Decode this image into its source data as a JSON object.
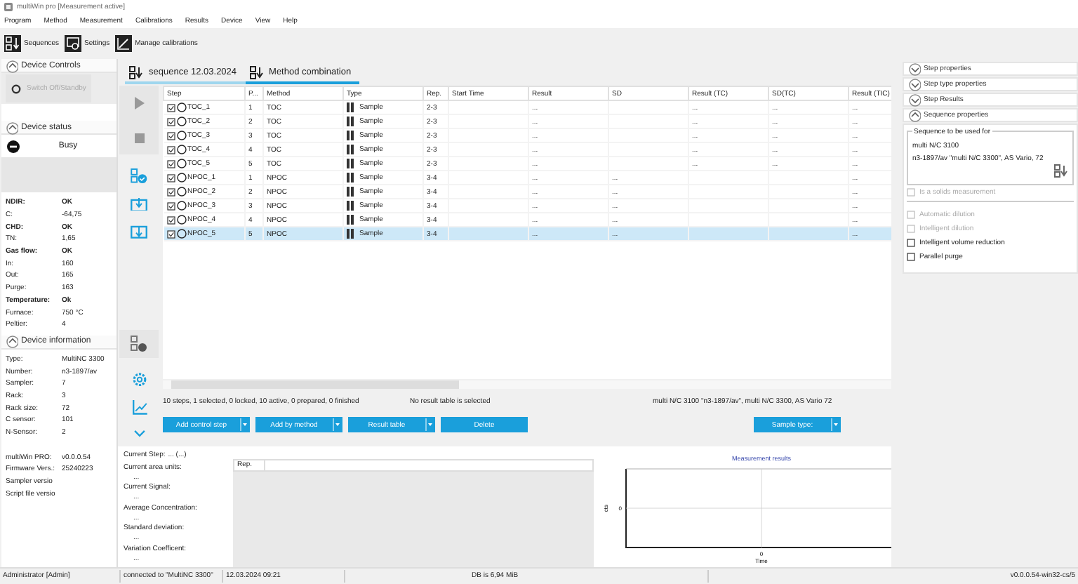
{
  "window": {
    "title": "multiWin pro [Measurement active]"
  },
  "menu": [
    "Program",
    "Method",
    "Measurement",
    "Calibrations",
    "Results",
    "Device",
    "View",
    "Help"
  ],
  "toolbar": [
    {
      "label": "Sequences",
      "kind": "sequences"
    },
    {
      "label": "Settings",
      "kind": "settings"
    },
    {
      "label": "Manage calibrations",
      "kind": "calibrations"
    }
  ],
  "device_controls": {
    "title": "Device Controls",
    "expanded": true,
    "button": {
      "label": "Switch Off/Standby",
      "disabled": true
    }
  },
  "device_status": {
    "title": "Device status",
    "expanded": true,
    "state": "Busy",
    "readings": [
      {
        "label": "NDIR:",
        "value": "OK",
        "kind": "group"
      },
      {
        "label": "C:",
        "value": "-64,75",
        "kind": "item"
      },
      {
        "label": "CHD:",
        "value": "OK",
        "kind": "group"
      },
      {
        "label": "TN:",
        "value": "1,65",
        "kind": "item"
      },
      {
        "label": "Gas flow:",
        "value": "OK",
        "kind": "group"
      },
      {
        "label": "In:",
        "value": "160",
        "kind": "item"
      },
      {
        "label": "Out:",
        "value": "165",
        "kind": "item"
      },
      {
        "label": "Purge:",
        "value": "163",
        "kind": "item"
      },
      {
        "label": "Temperature:",
        "value": "Ok",
        "kind": "group"
      },
      {
        "label": "Furnace:",
        "value": "750 °C",
        "kind": "item"
      },
      {
        "label": "Peltier:",
        "value": "4",
        "kind": "item"
      }
    ]
  },
  "device_information": {
    "title": "Device information",
    "expanded": true,
    "hardware": [
      {
        "label": "Type:",
        "value": "MultiNC 3300"
      },
      {
        "label": "Number:",
        "value": "n3-1897/av"
      },
      {
        "label": "Sampler:",
        "value": "7"
      },
      {
        "label": "Rack:",
        "value": "3"
      },
      {
        "label": "Rack size:",
        "value": "72"
      },
      {
        "label": "C sensor:",
        "value": "101"
      },
      {
        "label": "N-Sensor:",
        "value": "2"
      }
    ],
    "software": [
      {
        "label": "multiWin PRO:",
        "value": "v0.0.0.54"
      },
      {
        "label": "Firmware Vers.:",
        "value": "25240223"
      },
      {
        "label": "Sampler versio"
      },
      {
        "label": "Script file versio"
      }
    ]
  },
  "tabs": [
    {
      "label": "sequence 12.03.2024",
      "selected": false
    },
    {
      "label": "Method combination",
      "selected": true
    }
  ],
  "table": {
    "columns": [
      "Step",
      "P...",
      "Method",
      "Type",
      "Rep.",
      "Start Time",
      "Result",
      "SD",
      "Result (TC)",
      "SD(TC)",
      "Result (TIC)"
    ],
    "rows": [
      {
        "checked": true,
        "selected": false,
        "cells": [
          "TOC_1",
          "1",
          "TOC",
          "Sample",
          "2-3",
          "",
          "...",
          "",
          "...",
          "...",
          "..."
        ]
      },
      {
        "checked": true,
        "selected": false,
        "cells": [
          "TOC_2",
          "2",
          "TOC",
          "Sample",
          "2-3",
          "",
          "...",
          "",
          "...",
          "...",
          "..."
        ]
      },
      {
        "checked": true,
        "selected": false,
        "cells": [
          "TOC_3",
          "3",
          "TOC",
          "Sample",
          "2-3",
          "",
          "...",
          "",
          "...",
          "...",
          "..."
        ]
      },
      {
        "checked": true,
        "selected": false,
        "cells": [
          "TOC_4",
          "4",
          "TOC",
          "Sample",
          "2-3",
          "",
          "...",
          "",
          "...",
          "...",
          "..."
        ]
      },
      {
        "checked": true,
        "selected": false,
        "cells": [
          "TOC_5",
          "5",
          "TOC",
          "Sample",
          "2-3",
          "",
          "...",
          "",
          "...",
          "...",
          "..."
        ]
      },
      {
        "checked": true,
        "selected": false,
        "cells": [
          "NPOC_1",
          "1",
          "NPOC",
          "Sample",
          "3-4",
          "",
          "...",
          "...",
          "",
          "",
          "..."
        ]
      },
      {
        "checked": true,
        "selected": false,
        "cells": [
          "NPOC_2",
          "2",
          "NPOC",
          "Sample",
          "3-4",
          "",
          "...",
          "...",
          "",
          "",
          "..."
        ]
      },
      {
        "checked": true,
        "selected": false,
        "cells": [
          "NPOC_3",
          "3",
          "NPOC",
          "Sample",
          "3-4",
          "",
          "...",
          "...",
          "",
          "",
          "..."
        ]
      },
      {
        "checked": true,
        "selected": false,
        "cells": [
          "NPOC_4",
          "4",
          "NPOC",
          "Sample",
          "3-4",
          "",
          "...",
          "...",
          "",
          "",
          "..."
        ]
      },
      {
        "checked": true,
        "selected": true,
        "cells": [
          "NPOC_5",
          "5",
          "NPOC",
          "Sample",
          "3-4",
          "",
          "...",
          "...",
          "",
          "",
          "..."
        ]
      }
    ]
  },
  "summary": [
    "10 steps, 1 selected, 0 locked, 10 active, 0 prepared, 0 finished",
    "No result table is selected",
    "multi N/C 3100 \"n3-1897/av\", multi N/C 3300, AS Vario 72"
  ],
  "actions": [
    {
      "label": "Add control step",
      "dropdown": true
    },
    {
      "label": "Add by method",
      "dropdown": true
    },
    {
      "label": "Result table",
      "dropdown": true
    },
    {
      "label": "Delete",
      "dropdown": false
    }
  ],
  "sample_type": {
    "label": "Sample type:",
    "dropdown": true
  },
  "current_step": {
    "label": "Current Step:",
    "value": "... (...)"
  },
  "measurements": [
    {
      "label": "Current area units:",
      "value": "..."
    },
    {
      "label": "Current Signal:",
      "value": "..."
    },
    {
      "label": "Average Concentration:",
      "value": "..."
    },
    {
      "label": "Standard deviation:",
      "value": "..."
    },
    {
      "label": "Variation Coefficent:",
      "value": "..."
    }
  ],
  "rep_table": {
    "columns": [
      "Rep."
    ]
  },
  "chart": {
    "title": "Measurement results",
    "xlabel": "Time",
    "ylabel": "cts",
    "x_tick": "0",
    "y_tick": "0"
  },
  "properties": {
    "sections": [
      {
        "title": "Step properties",
        "expanded": false
      },
      {
        "title": "Step type properties",
        "expanded": false
      },
      {
        "title": "Step Results",
        "expanded": false
      },
      {
        "title": "Sequence properties",
        "expanded": true
      }
    ],
    "group": {
      "title": "Sequence to be used for",
      "lines": [
        "multi N/C 3100",
        "n3-1897/av \"multi N/C 3300\", AS Vario, 72"
      ]
    },
    "options": [
      {
        "label": "Is a solids measurement",
        "checked": false,
        "disabled": true
      },
      {
        "label": "Automatic dilution",
        "checked": false,
        "disabled": true
      },
      {
        "label": "Intelligent dilution",
        "checked": false,
        "disabled": true
      },
      {
        "label": "Intelligent volume reduction",
        "checked": false,
        "disabled": false
      },
      {
        "label": "Parallel purge",
        "checked": false,
        "disabled": false
      }
    ]
  },
  "status_bar": [
    "Administrator [Admin]",
    "connected to \"MultiNC 3300\"",
    "12.03.2024 09:21",
    "DB is 6,94 MiB",
    "v0.0.0.54-win32-cs/5"
  ]
}
